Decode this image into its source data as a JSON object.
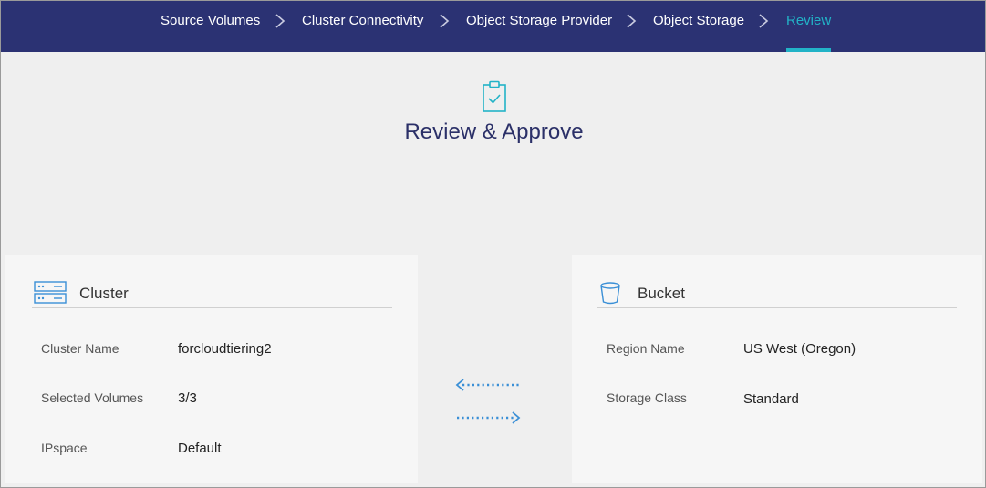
{
  "wizard": {
    "steps": [
      {
        "label": "Source Volumes"
      },
      {
        "label": "Cluster Connectivity"
      },
      {
        "label": "Object Storage Provider"
      },
      {
        "label": "Object Storage"
      },
      {
        "label": "Review"
      }
    ],
    "active_step": "Review",
    "accent_color": "#22b3c7",
    "bar_color": "#2b3273"
  },
  "hero": {
    "icon": "clipboard-check-icon",
    "title": "Review & Approve"
  },
  "cluster": {
    "icon": "server-rack-icon",
    "title": "Cluster",
    "fields": [
      {
        "label": "Cluster Name",
        "value": "forcloudtiering2"
      },
      {
        "label": "Selected Volumes",
        "value": "3/3"
      },
      {
        "label": "IPspace",
        "value": "Default"
      }
    ]
  },
  "bucket": {
    "icon": "bucket-icon",
    "title": "Bucket",
    "fields": [
      {
        "label": "Region Name",
        "value": "US West (Oregon)"
      },
      {
        "label": "Storage Class",
        "value": "Standard"
      }
    ]
  },
  "connection": {
    "icon": "bidirectional-arrows-icon"
  }
}
